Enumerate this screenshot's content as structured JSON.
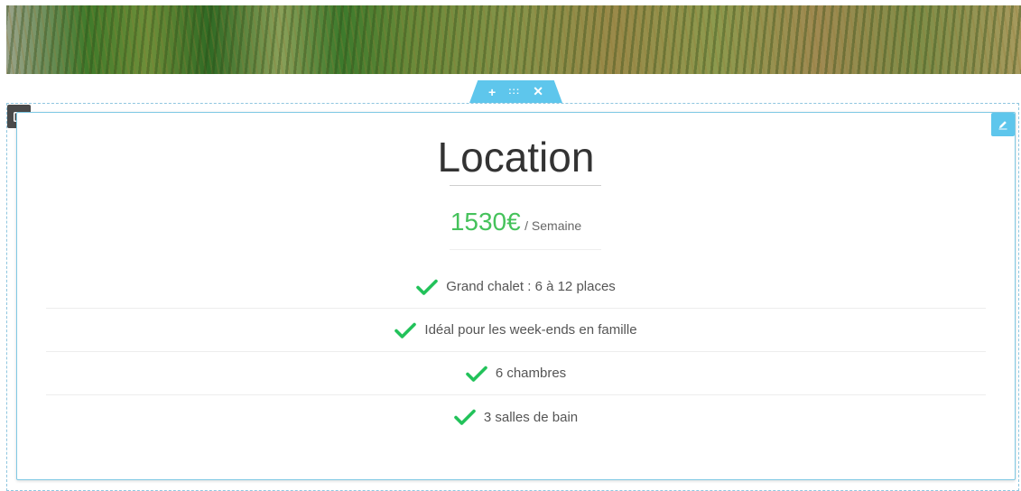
{
  "toolbar": {
    "add_icon_char": "+",
    "drag_icon_char": ":::",
    "close_icon_char": "✕"
  },
  "card": {
    "title": "Location",
    "price": "1530€",
    "period": "/ Semaine",
    "features": [
      "Grand chalet : 6 à 12 places",
      "Idéal pour les week-ends en famille",
      "6 chambres",
      "3 salles de bain"
    ]
  },
  "colors": {
    "accent": "#5ec6ec",
    "price": "#45c25b",
    "check": "#22c25a"
  }
}
